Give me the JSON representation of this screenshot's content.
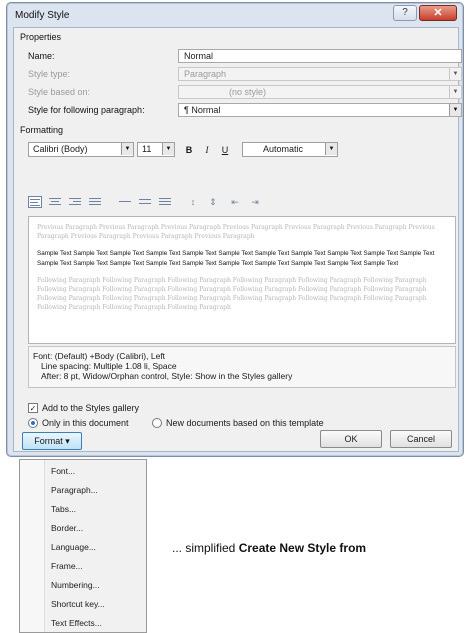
{
  "dialog": {
    "title": "Modify Style",
    "help_label": "?",
    "close_label": "✕"
  },
  "properties": {
    "section_label": "Properties",
    "name_label": "Name:",
    "name_value": "Normal",
    "style_type_label": "Style type:",
    "style_type_value": "Paragraph",
    "style_based_on_label": "Style based on:",
    "style_based_on_value": "(no style)",
    "following_label": "Style for following paragraph:",
    "following_value": "¶ Normal"
  },
  "formatting": {
    "section_label": "Formatting",
    "font": "Calibri (Body)",
    "size": "11",
    "bold": "B",
    "italic": "I",
    "underline": "U",
    "color": "Automatic"
  },
  "preview": {
    "previous": "Previous Paragraph Previous Paragraph Previous Paragraph Previous Paragraph Previous Paragraph Previous Paragraph Previous Paragraph Previous Paragraph Previous Paragraph Previous Paragraph",
    "sample": "Sample Text Sample Text Sample Text Sample Text Sample Text Sample Text Sample Text Sample Text Sample Text Sample Text Sample Text Sample Text Sample Text Sample Text Sample Text Sample Text Sample Text Sample Text Sample Text Sample Text Sample Text",
    "following": "Following Paragraph Following Paragraph Following Paragraph Following Paragraph Following Paragraph Following Paragraph Following Paragraph Following Paragraph Following Paragraph Following Paragraph Following Paragraph Following Paragraph Following Paragraph Following Paragraph Following Paragraph Following Paragraph Following Paragraph Following Paragraph Following Paragraph Following Paragraph Following Paragraph"
  },
  "description": {
    "line1": "Font: (Default) +Body (Calibri), Left",
    "line2": "Line spacing: Multiple 1.08 li, Space",
    "line3": "After: 8 pt, Widow/Orphan control, Style: Show in the Styles gallery"
  },
  "options": {
    "add_to_gallery": "Add to the Styles gallery",
    "only_this_doc": "Only in this document",
    "new_docs": "New documents based on this template"
  },
  "buttons": {
    "format": "Format ▾",
    "ok": "OK",
    "cancel": "Cancel"
  },
  "menu": {
    "items": [
      "Font...",
      "Paragraph...",
      "Tabs...",
      "Border...",
      "Language...",
      "Frame...",
      "Numbering...",
      "Shortcut key...",
      "Text Effects..."
    ]
  },
  "caption": {
    "prefix": "... simplified ",
    "bold": "Create New Style from"
  }
}
